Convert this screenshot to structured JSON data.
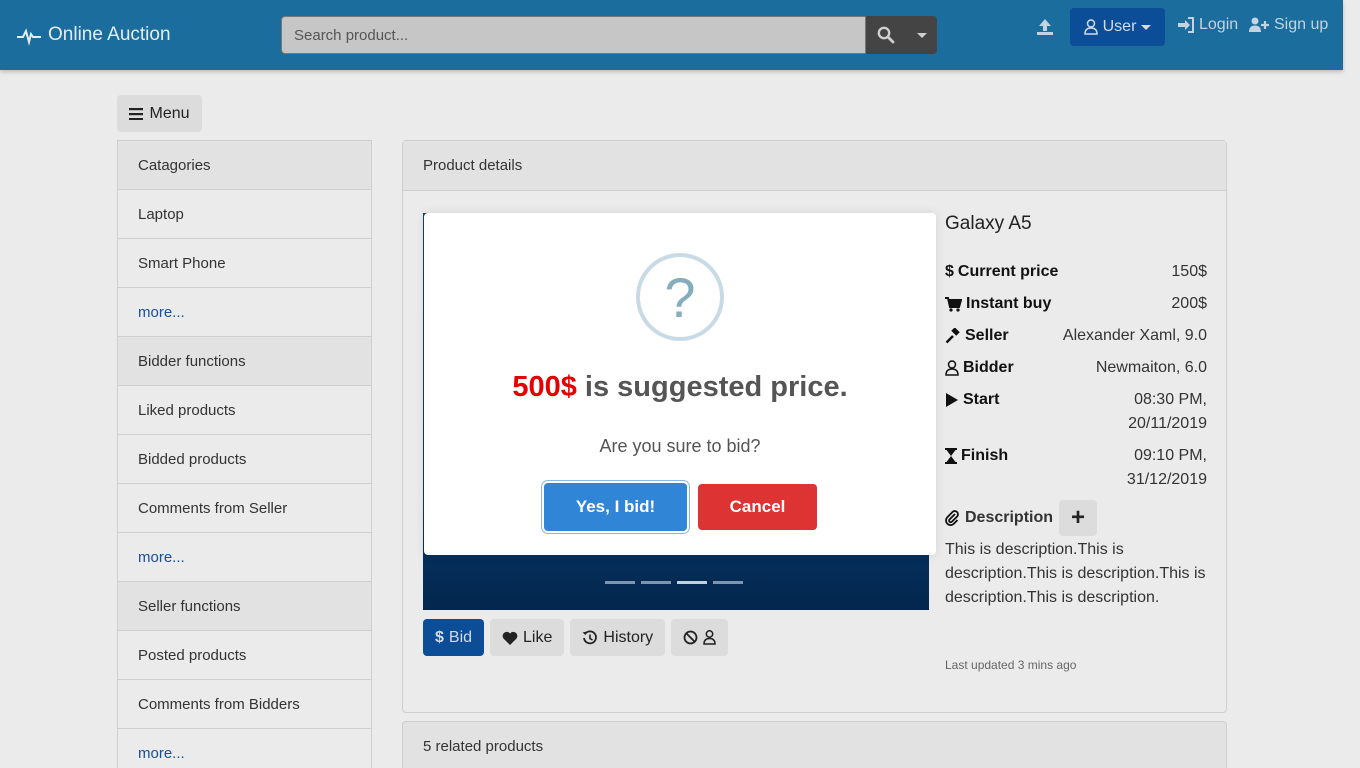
{
  "navbar": {
    "brand": "Online Auction",
    "search_placeholder": "Search product...",
    "user_label": "User",
    "login_label": "Login",
    "signup_label": "Sign up"
  },
  "menu_button": "Menu",
  "sidebar": {
    "items": [
      {
        "label": "Catagories",
        "type": "head"
      },
      {
        "label": "Laptop",
        "type": "item"
      },
      {
        "label": "Smart Phone",
        "type": "item"
      },
      {
        "label": "more...",
        "type": "more"
      },
      {
        "label": "Bidder functions",
        "type": "head"
      },
      {
        "label": "Liked products",
        "type": "item"
      },
      {
        "label": "Bidded products",
        "type": "item"
      },
      {
        "label": "Comments from Seller",
        "type": "item"
      },
      {
        "label": "more...",
        "type": "more"
      },
      {
        "label": "Seller functions",
        "type": "head"
      },
      {
        "label": "Posted products",
        "type": "item"
      },
      {
        "label": "Comments from Bidders",
        "type": "item"
      },
      {
        "label": "more...",
        "type": "more"
      }
    ]
  },
  "product": {
    "panel_title": "Product details",
    "name": "Galaxy A5",
    "current_price_label": "Current price",
    "current_price": "150$",
    "instant_buy_label": "Instant buy",
    "instant_buy": "200$",
    "seller_label": "Seller",
    "seller": "Alexander Xaml, 9.0",
    "bidder_label": "Bidder",
    "bidder": "Newmaiton, 6.0",
    "start_label": "Start",
    "start": "08:30 PM, 20/11/2019",
    "finish_label": "Finish",
    "finish": "09:10 PM, 31/12/2019",
    "description_label": "Description",
    "description": "This is description.This is description.This is description.This is description.This is description.",
    "last_updated": "Last updated 3 mins ago",
    "carousel_slides": 4,
    "carousel_active": 3
  },
  "actions": {
    "bid": "Bid",
    "like": "Like",
    "history": "History"
  },
  "related": "5 related products",
  "modal": {
    "price": "500$",
    "title_rest": " is suggested price.",
    "text": "Are you sure to bid?",
    "confirm": "Yes, I bid!",
    "cancel": "Cancel",
    "icon": "?"
  },
  "colors": {
    "navbar": "#1a6d9c",
    "primary": "#0b4d97",
    "confirm": "#3085d6",
    "cancel": "#dd3333",
    "price_highlight": "#e60000"
  }
}
